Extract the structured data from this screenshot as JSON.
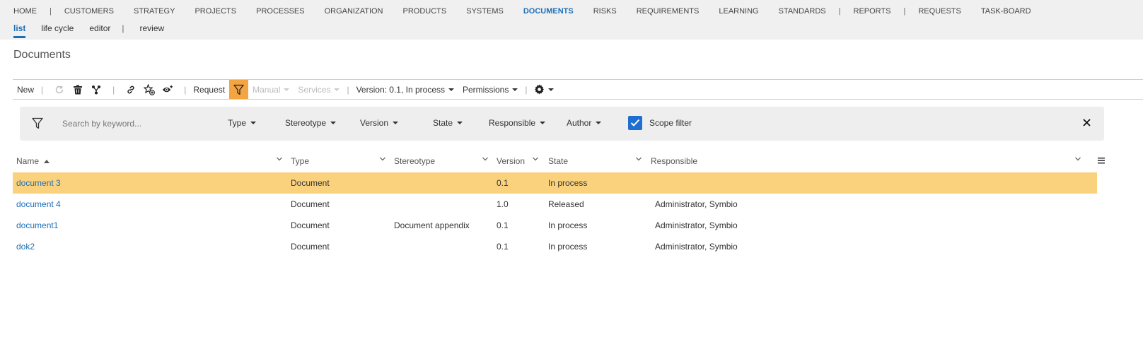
{
  "nav": {
    "main": [
      {
        "label": "HOME"
      },
      {
        "sep": "|"
      },
      {
        "label": "CUSTOMERS"
      },
      {
        "label": "STRATEGY"
      },
      {
        "label": "PROJECTS"
      },
      {
        "label": "PROCESSES"
      },
      {
        "label": "ORGANIZATION"
      },
      {
        "label": "PRODUCTS"
      },
      {
        "label": "SYSTEMS"
      },
      {
        "label": "DOCUMENTS",
        "active": true
      },
      {
        "label": "RISKS"
      },
      {
        "label": "REQUIREMENTS"
      },
      {
        "label": "LEARNING"
      },
      {
        "label": "STANDARDS"
      },
      {
        "sep": "|"
      },
      {
        "label": "REPORTS"
      },
      {
        "sep": "|"
      },
      {
        "label": "REQUESTS"
      },
      {
        "label": "TASK-BOARD"
      }
    ],
    "sub": [
      {
        "label": "list",
        "active": true
      },
      {
        "label": "life cycle"
      },
      {
        "label": "editor"
      },
      {
        "sep": "|"
      },
      {
        "label": "review"
      }
    ]
  },
  "page_title": "Documents",
  "toolbar": {
    "new_label": "New",
    "request_label": "Request",
    "manual_label": "Manual",
    "services_label": "Services",
    "version_label": "Version: 0.1, In process",
    "permissions_label": "Permissions",
    "sep": "|"
  },
  "filter": {
    "search_placeholder": "Search by keyword...",
    "type_label": "Type",
    "stereotype_label": "Stereotype",
    "version_label": "Version",
    "state_label": "State",
    "responsible_label": "Responsible",
    "author_label": "Author",
    "scope_label": "Scope filter",
    "scope_checked": true
  },
  "grid": {
    "columns": {
      "name": "Name",
      "type": "Type",
      "stereotype": "Stereotype",
      "version": "Version",
      "state": "State",
      "responsible": "Responsible"
    },
    "rows": [
      {
        "name": "document 3",
        "type": "Document",
        "stereotype": "",
        "version": "0.1",
        "state": "In process",
        "responsible": "",
        "selected": true
      },
      {
        "name": "document 4",
        "type": "Document",
        "stereotype": "",
        "version": "1.0",
        "state": "Released",
        "responsible": "Administrator, Symbio"
      },
      {
        "name": "document1",
        "type": "Document",
        "stereotype": "Document appendix",
        "version": "0.1",
        "state": "In process",
        "responsible": "Administrator, Symbio"
      },
      {
        "name": "dok2",
        "type": "Document",
        "stereotype": "",
        "version": "0.1",
        "state": "In process",
        "responsible": "Administrator, Symbio"
      }
    ]
  },
  "colors": {
    "accent": "#1f6fb7",
    "selected_row": "#fad27e",
    "filter_active": "#f2a541",
    "checkbox": "#1f6fd1"
  },
  "icons": [
    "refresh-icon",
    "trash-icon",
    "branch-icon",
    "link-icon",
    "star-add-icon",
    "eye-add-icon",
    "funnel-icon",
    "gear-icon",
    "close-icon",
    "chevron-down-icon",
    "columns-menu-icon",
    "check-icon"
  ]
}
